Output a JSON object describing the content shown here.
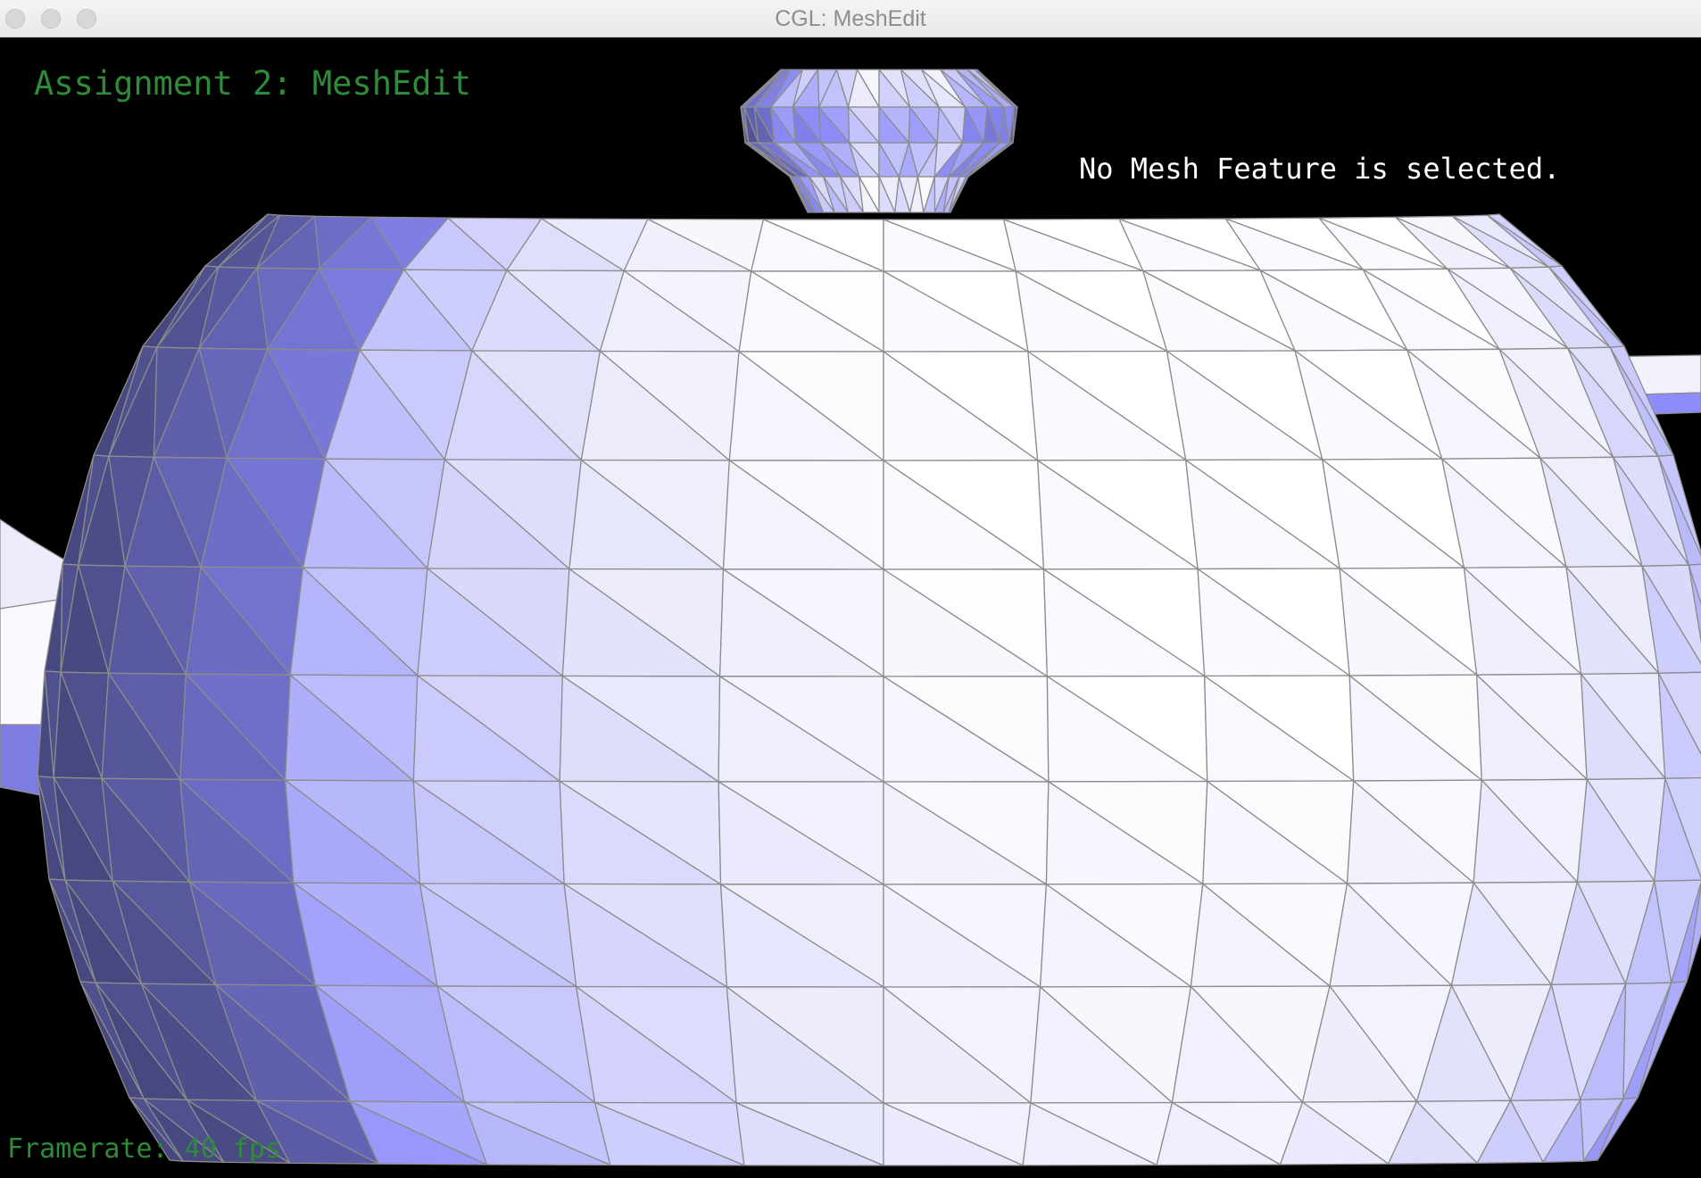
{
  "window": {
    "title": "CGL: MeshEdit"
  },
  "overlay": {
    "assignment_title": "Assignment 2: MeshEdit",
    "selection_status": "No Mesh Feature is selected.",
    "framerate": "Framerate: 40 fps"
  },
  "colors": {
    "background": "#000000",
    "hud_green": "#2e8b3a",
    "mesh_edge": "#8c8c8c",
    "mesh_shade_light": "#ffffff",
    "mesh_shade_dark": "#5a5aa8"
  },
  "scene": {
    "model": "teapot",
    "render_mode": "shaded wireframe"
  }
}
